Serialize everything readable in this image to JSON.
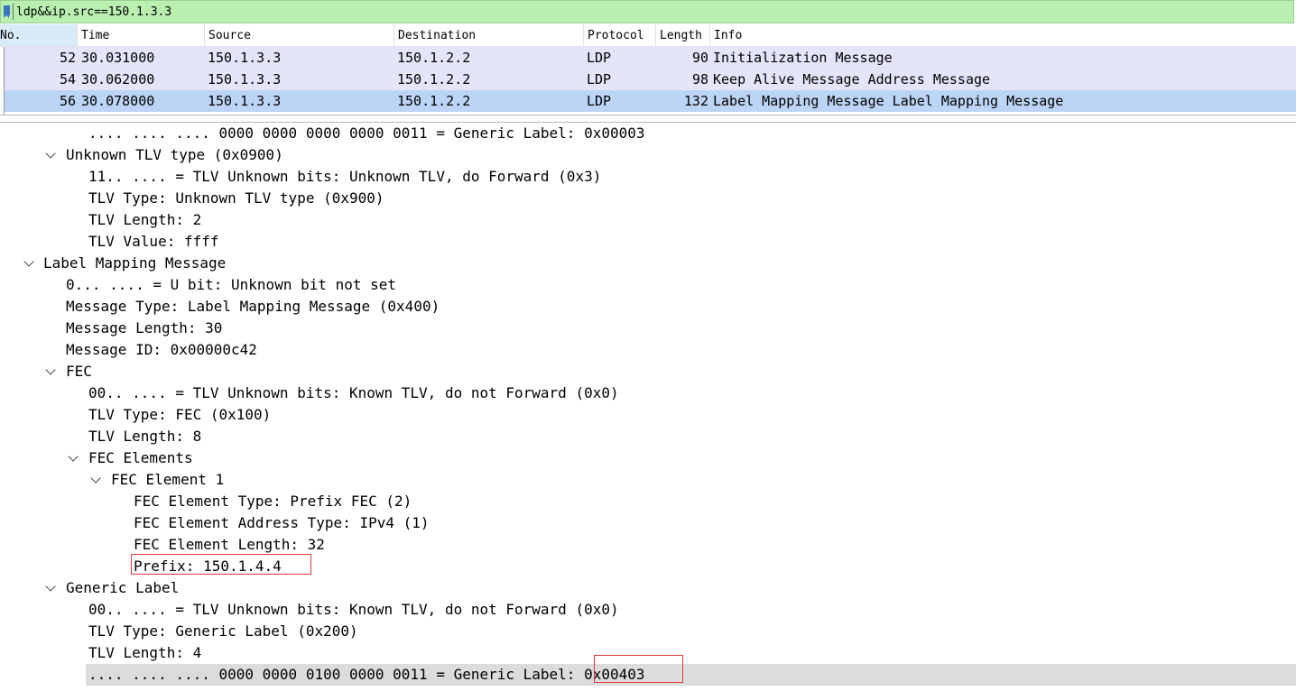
{
  "filter": {
    "text": "ldp&&ip.src==150.1.3.3"
  },
  "columns": [
    "No.",
    "Time",
    "Source",
    "Destination",
    "Protocol",
    "Length",
    "Info"
  ],
  "packets": [
    {
      "no": "52",
      "time": "30.031000",
      "source": "150.1.3.3",
      "destination": "150.1.2.2",
      "protocol": "LDP",
      "length": "90",
      "info": "Initialization Message"
    },
    {
      "no": "54",
      "time": "30.062000",
      "source": "150.1.3.3",
      "destination": "150.1.2.2",
      "protocol": "LDP",
      "length": "98",
      "info": "Keep Alive Message Address Message"
    },
    {
      "no": "56",
      "time": "30.078000",
      "source": "150.1.3.3",
      "destination": "150.1.2.2",
      "protocol": "LDP",
      "length": "132",
      "info": "Label Mapping Message Label Mapping Message"
    }
  ],
  "details": [
    {
      "text": ".... .... .... 0000 0000 0000 0000 0011 = Generic Label: 0x00003"
    },
    {
      "text": "Unknown TLV type (0x0900)"
    },
    {
      "text": "11.. .... = TLV Unknown bits: Unknown TLV, do Forward (0x3)"
    },
    {
      "text": "TLV Type: Unknown TLV type (0x900)"
    },
    {
      "text": "TLV Length: 2"
    },
    {
      "text": "TLV Value: ffff"
    },
    {
      "text": "Label Mapping Message"
    },
    {
      "text": "0... .... = U bit: Unknown bit not set"
    },
    {
      "text": "Message Type: Label Mapping Message (0x400)"
    },
    {
      "text": "Message Length: 30"
    },
    {
      "text": "Message ID: 0x00000c42"
    },
    {
      "text": "FEC"
    },
    {
      "text": "00.. .... = TLV Unknown bits: Known TLV, do not Forward (0x0)"
    },
    {
      "text": "TLV Type: FEC (0x100)"
    },
    {
      "text": "TLV Length: 8"
    },
    {
      "text": "FEC Elements"
    },
    {
      "text": "FEC Element 1"
    },
    {
      "text": "FEC Element Type: Prefix FEC (2)"
    },
    {
      "text": "FEC Element Address Type: IPv4 (1)"
    },
    {
      "text": "FEC Element Length: 32"
    },
    {
      "text": "Prefix: 150.1.4.4"
    },
    {
      "text": "Generic Label"
    },
    {
      "text": "00.. .... = TLV Unknown bits: Known TLV, do not Forward (0x0)"
    },
    {
      "text": "TLV Type: Generic Label (0x200)"
    },
    {
      "text": "TLV Length: 4"
    },
    {
      "text": ".... .... .... 0000 0000 0100 0000 0011 = Generic Label: 0x00403"
    }
  ],
  "colors": {
    "filter_bg": "#b9f0b0",
    "row_bg": "#e4e4fa",
    "row_selected_bg": "#bcd4f5",
    "highlight_bg": "#dcdcdc",
    "annotation_box": "#e23b3b"
  }
}
